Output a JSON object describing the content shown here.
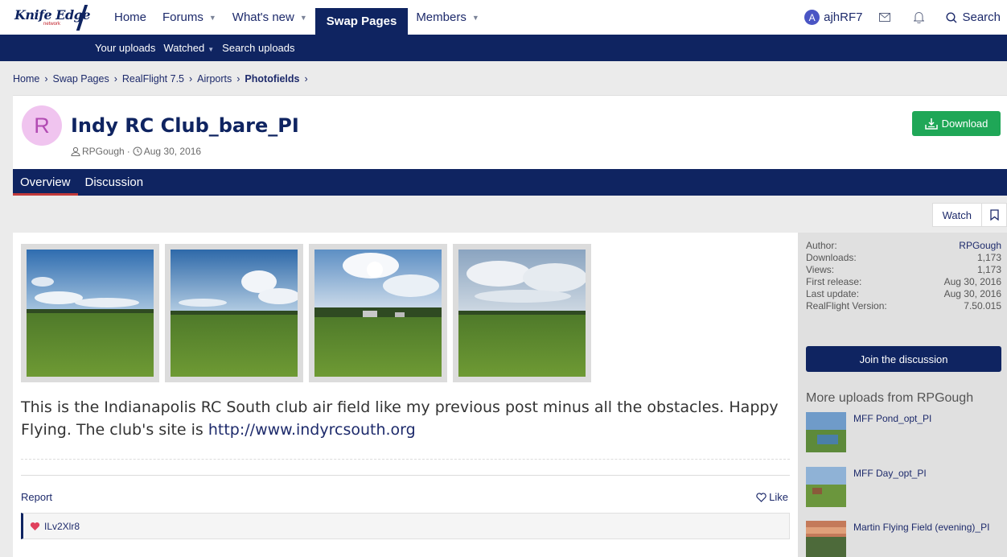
{
  "brand": {
    "logo": "Knife Edge",
    "logo_sub": "network"
  },
  "nav": {
    "items": [
      {
        "label": "Home",
        "caret": false
      },
      {
        "label": "Forums",
        "caret": true
      },
      {
        "label": "What's new",
        "caret": true
      },
      {
        "label": "Swap Pages",
        "caret": false,
        "active": true
      },
      {
        "label": "Members",
        "caret": true
      }
    ],
    "user": {
      "initial": "A",
      "name": "ajhRF7"
    },
    "search_label": "Search"
  },
  "subnav": {
    "items": [
      "Your uploads",
      "Watched",
      "Search uploads"
    ]
  },
  "breadcrumb": [
    "Home",
    "Swap Pages",
    "RealFlight 7.5",
    "Airports",
    "Photofields"
  ],
  "resource": {
    "avatar_initial": "R",
    "title": "Indy RC Club_bare_PI",
    "author": "RPGough",
    "date": "Aug 30, 2016",
    "download_label": "Download"
  },
  "tabs": [
    "Overview",
    "Discussion"
  ],
  "watch": {
    "label": "Watch"
  },
  "description": {
    "text": "This is the Indianapolis RC South club air field like my previous post minus all the obstacles. Happy Flying. The club's site is ",
    "link": "http://www.indyrcsouth.org"
  },
  "actions": {
    "report": "Report",
    "like": "Like"
  },
  "reaction_user": "ILv2Xlr8",
  "info": [
    {
      "label": "Author:",
      "value": "RPGough"
    },
    {
      "label": "Downloads:",
      "value": "1,173"
    },
    {
      "label": "Views:",
      "value": "1,173"
    },
    {
      "label": "First release:",
      "value": "Aug 30, 2016"
    },
    {
      "label": "Last update:",
      "value": "Aug 30, 2016"
    },
    {
      "label": "RealFlight Version:",
      "value": "7.50.015"
    }
  ],
  "join_label": "Join the discussion",
  "more": {
    "title": "More uploads from RPGough",
    "items": [
      "MFF Pond_opt_PI",
      "MFF Day_opt_PI",
      "Martin Flying Field (evening)_PI"
    ]
  },
  "colors": {
    "navy": "#0f2461",
    "download_green": "#1fa757",
    "tab_underline": "#c23a3a"
  }
}
